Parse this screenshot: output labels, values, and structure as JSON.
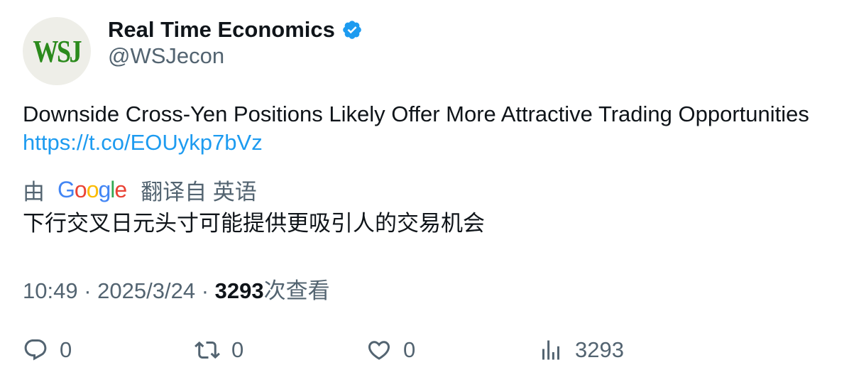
{
  "author": {
    "avatar_text": "WSJ",
    "display_name": "Real Time Economics",
    "handle": "@WSJecon",
    "verified": true
  },
  "tweet": {
    "text": "Downside Cross-Yen Positions Likely Offer More Attractive Trading Opportunities",
    "link": "https://t.co/EOUykp7bVz"
  },
  "translation": {
    "prefix": "由",
    "provider": "Google",
    "suffix": "翻译自 英语",
    "text": "下行交叉日元头寸可能提供更吸引人的交易机会"
  },
  "meta": {
    "time": "10:49",
    "separator": "·",
    "date": "2025/3/24",
    "views_count": "3293",
    "views_label": "次查看"
  },
  "actions": {
    "reply_count": "0",
    "retweet_count": "0",
    "like_count": "0",
    "views_count": "3293"
  },
  "colors": {
    "text_primary": "#0f1419",
    "text_secondary": "#536471",
    "link": "#1d9bf0",
    "verified": "#1d9bf0",
    "avatar_bg": "#eeeee8",
    "avatar_text": "#2b8a1c"
  }
}
